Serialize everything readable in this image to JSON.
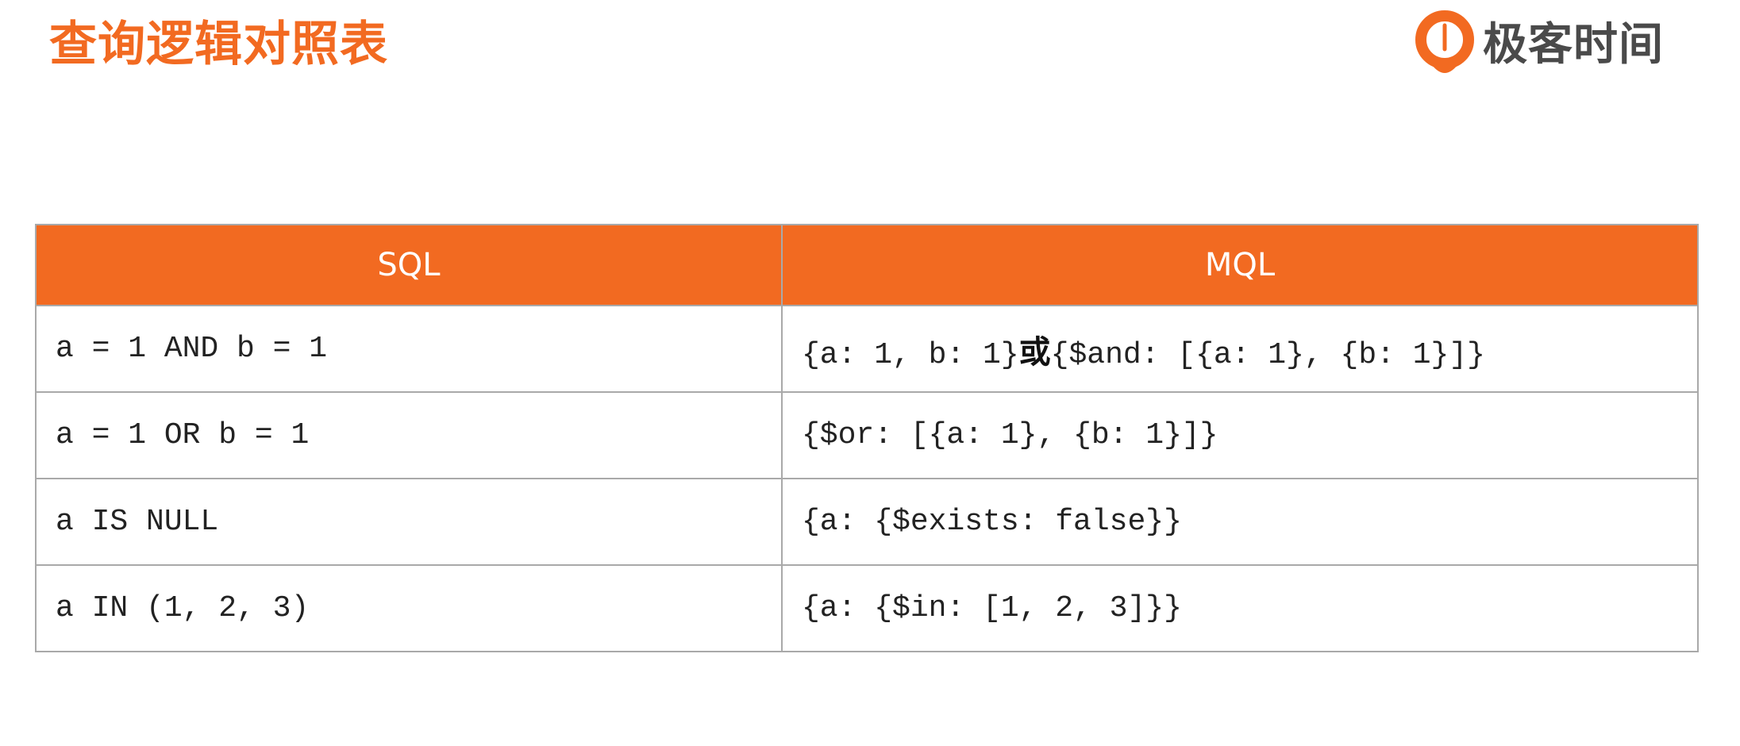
{
  "page": {
    "title": "查询逻辑对照表"
  },
  "brand": {
    "name": "极客时间",
    "accent_color": "#f26a21",
    "logo_icon": "geektime-logo-icon"
  },
  "table": {
    "header_color": "#f26a21",
    "columns": [
      "SQL",
      "MQL"
    ],
    "rows": [
      {
        "sql": "a = 1 AND b = 1",
        "mql_part1": "{a: 1, b: 1}",
        "mql_or": "或",
        "mql_part2": "{$and: [{a: 1}, {b: 1}]}"
      },
      {
        "sql": "a = 1 OR b = 1",
        "mql": "{$or: [{a: 1}, {b: 1}]}"
      },
      {
        "sql": "a IS NULL",
        "mql": "{a: {$exists: false}}"
      },
      {
        "sql": "a IN (1, 2, 3)",
        "mql": "{a: {$in: [1, 2, 3]}}"
      }
    ]
  }
}
